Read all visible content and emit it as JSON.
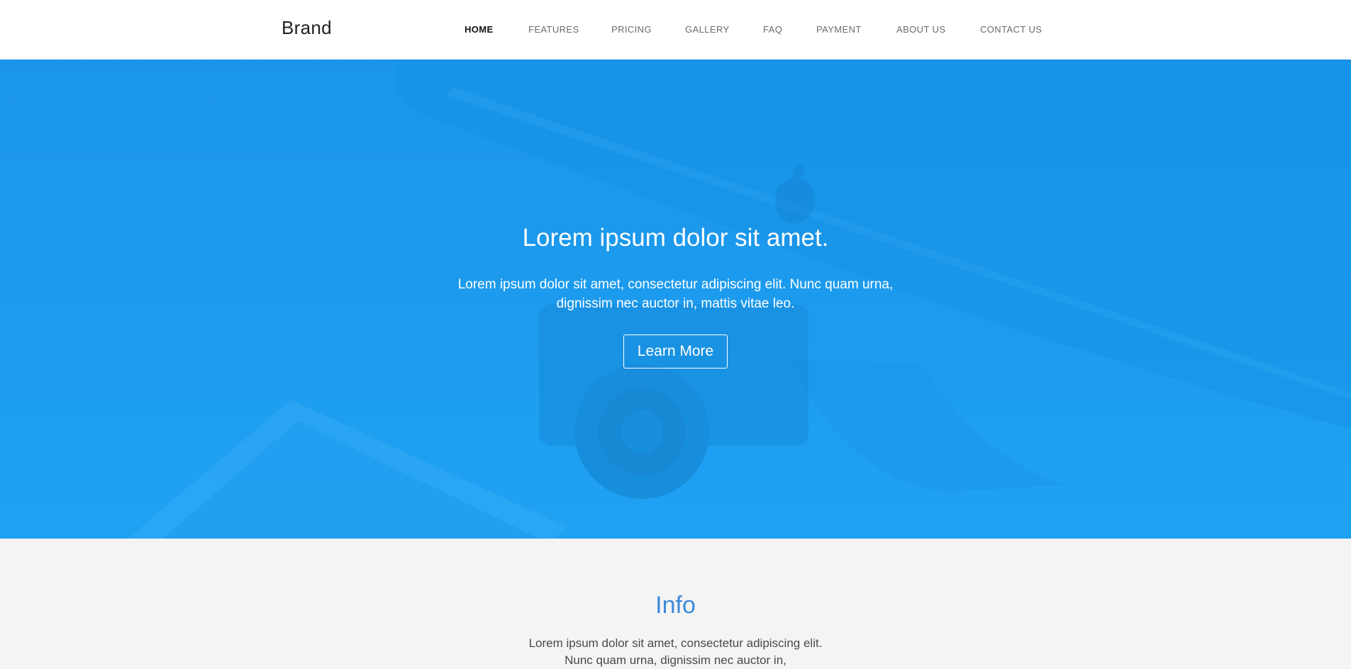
{
  "navbar": {
    "brand": "Brand",
    "links": [
      "HOME",
      "FEATURES",
      "PRICING",
      "GALLERY",
      "FAQ",
      "PAYMENT",
      "ABOUT US",
      "CONTACT US"
    ],
    "active": "HOME"
  },
  "hero": {
    "title": "Lorem ipsum dolor sit amet.",
    "text": "Lorem ipsum dolor sit amet, consectetur adipiscing elit. Nunc quam urna, dignissim nec auctor in, mattis vitae leo.",
    "button_label": "Learn More",
    "overlay_color": "#1e9cef"
  },
  "info": {
    "title": "Info",
    "text": "Lorem ipsum dolor sit amet, consectetur adipiscing elit. Nunc quam urna, dignissim nec auctor in,",
    "title_color": "#3b8ad9"
  }
}
